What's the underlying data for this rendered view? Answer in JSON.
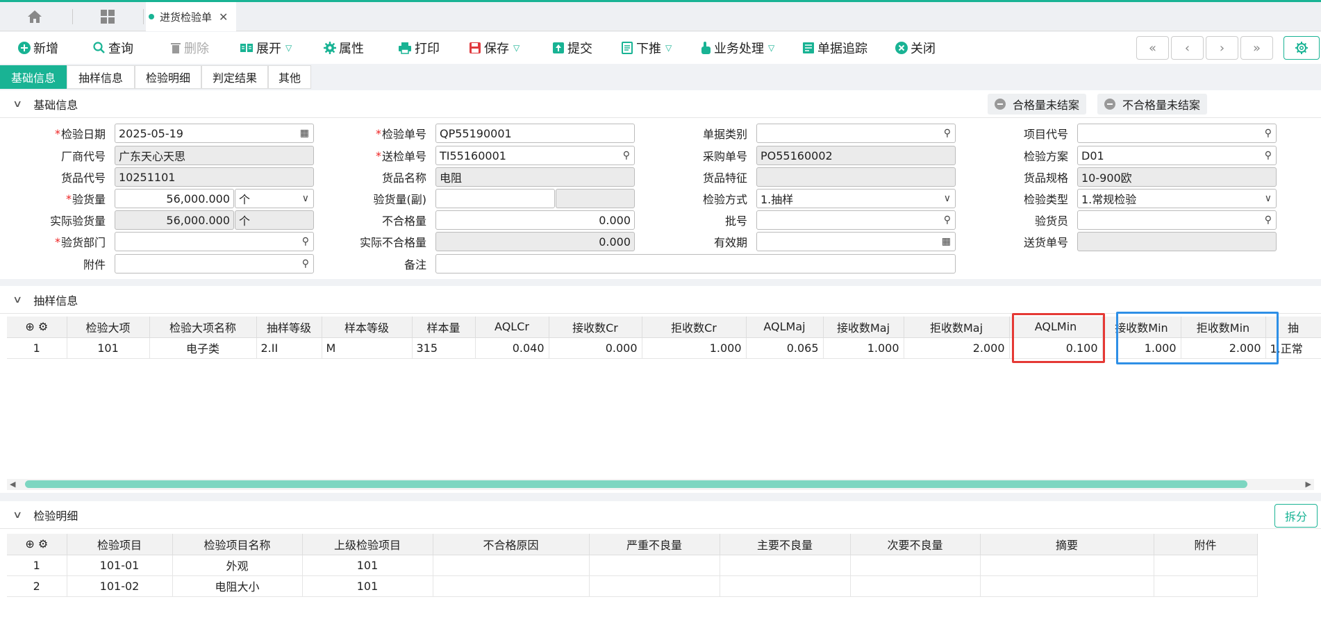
{
  "tabs": {
    "doc_tab_label": "进货检验单"
  },
  "toolbar": {
    "new": "新增",
    "query": "查询",
    "delete": "删除",
    "expand": "展开",
    "props": "属性",
    "print": "打印",
    "save": "保存",
    "submit": "提交",
    "push": "下推",
    "business": "业务处理",
    "track": "单据追踪",
    "close": "关闭"
  },
  "nav": {
    "first": "«",
    "prev": "‹",
    "next": "›",
    "last": "»"
  },
  "subtabs": [
    "基础信息",
    "抽样信息",
    "检验明细",
    "判定结果",
    "其他"
  ],
  "basic": {
    "title": "基础信息",
    "pills": [
      "合格量未结案",
      "不合格量未结案"
    ],
    "labels": {
      "inspect_date": "检验日期",
      "vendor_code": "厂商代号",
      "item_code": "货品代号",
      "inspect_qty": "验货量",
      "actual_inspect_qty": "实际验货量",
      "inspect_dept": "验货部门",
      "attachment": "附件",
      "inspect_no": "检验单号",
      "delivery_no": "送检单号",
      "item_name": "货品名称",
      "inspect_qty_aux": "验货量(副)",
      "unqualified_qty": "不合格量",
      "actual_unqualified_qty": "实际不合格量",
      "remark": "备注",
      "doc_type": "单据类别",
      "po_no": "采购单号",
      "item_feature": "货品特征",
      "inspect_method": "检验方式",
      "batch_no": "批号",
      "expiry": "有效期",
      "project_code": "项目代号",
      "inspect_plan": "检验方案",
      "item_spec": "货品规格",
      "inspect_type": "检验类型",
      "inspector": "验货员",
      "delivery_note_no": "送货单号"
    },
    "values": {
      "inspect_date": "2025-05-19",
      "vendor_code": "广东天心天思",
      "item_code": "10251101",
      "inspect_qty": "56,000.000",
      "inspect_unit": "个",
      "actual_inspect_qty": "56,000.000",
      "actual_unit": "个",
      "inspect_no": "QP55190001",
      "delivery_no": "TI55160001",
      "item_name": "电阻",
      "unqualified_qty": "0.000",
      "actual_unqualified_qty": "0.000",
      "po_no": "PO55160002",
      "inspect_method": "1.抽样",
      "inspect_plan": "D01",
      "item_spec": "10-900欧",
      "inspect_type": "1.常规检验"
    }
  },
  "sampling": {
    "title": "抽样信息",
    "columns": [
      "检验大项",
      "检验大项名称",
      "抽样等级",
      "样本等级",
      "样本量",
      "AQLCr",
      "接收数Cr",
      "拒收数Cr",
      "AQLMaj",
      "接收数Maj",
      "拒收数Maj",
      "AQLMin",
      "接收数Min",
      "拒收数Min",
      "抽"
    ],
    "rows": [
      [
        "1",
        "101",
        "电子类",
        "2.II",
        "M",
        "315",
        "0.040",
        "0.000",
        "1.000",
        "0.065",
        "1.000",
        "2.000",
        "0.100",
        "1.000",
        "2.000",
        "1.正常"
      ]
    ]
  },
  "detail": {
    "title": "检验明细",
    "split": "拆分",
    "columns": [
      "检验项目",
      "检验项目名称",
      "上级检验项目",
      "不合格原因",
      "严重不良量",
      "主要不良量",
      "次要不良量",
      "摘要",
      "附件"
    ],
    "rows": [
      [
        "1",
        "101-01",
        "外观",
        "101",
        "",
        "",
        "",
        "",
        "",
        ""
      ],
      [
        "2",
        "101-02",
        "电阻大小",
        "101",
        "",
        "",
        "",
        "",
        "",
        ""
      ]
    ]
  }
}
